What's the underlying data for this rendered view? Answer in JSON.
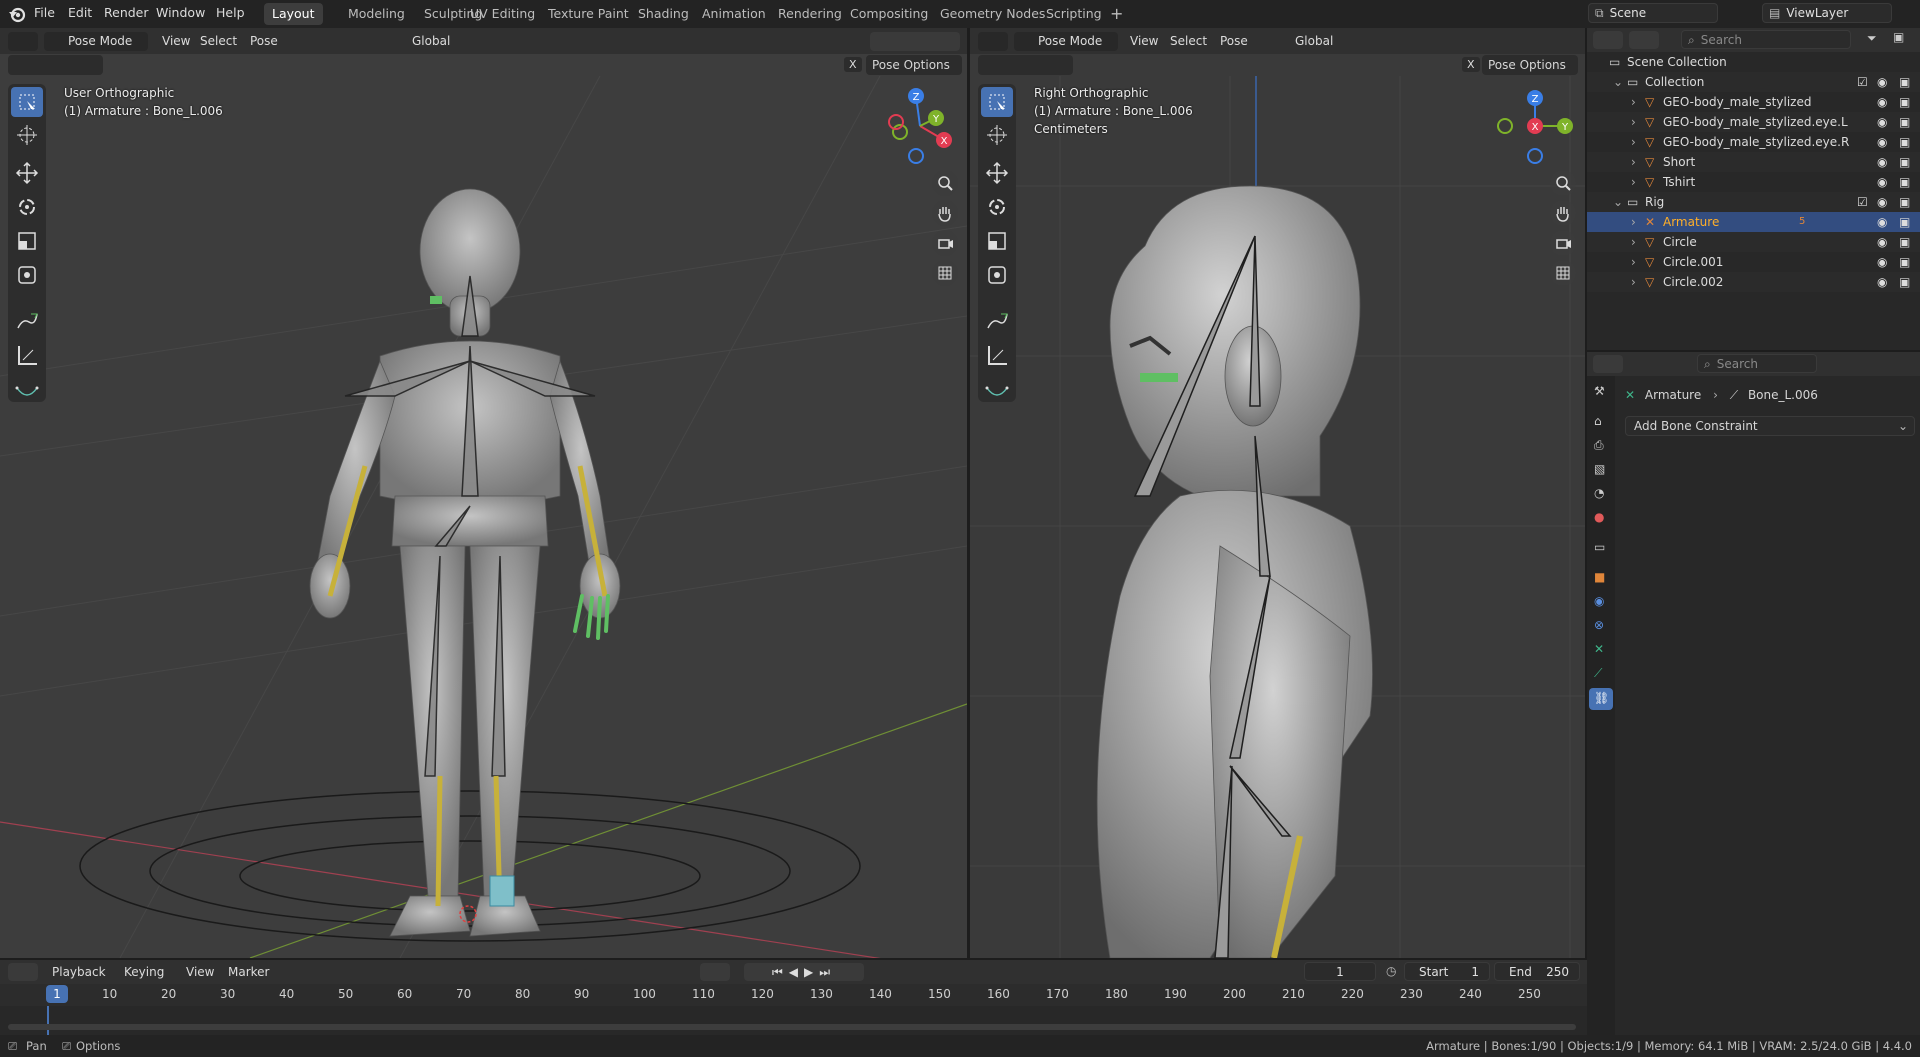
{
  "topbar": {
    "menus": [
      "File",
      "Edit",
      "Render",
      "Window",
      "Help"
    ],
    "workspaces": [
      "Layout",
      "Modeling",
      "Sculpting",
      "UV Editing",
      "Texture Paint",
      "Shading",
      "Animation",
      "Rendering",
      "Compositing",
      "Geometry Nodes",
      "Scripting"
    ],
    "active_workspace": "Layout",
    "scene": "Scene",
    "view_layer": "ViewLayer"
  },
  "left_viewport": {
    "mode": "Pose Mode",
    "menus": [
      "View",
      "Select",
      "Pose"
    ],
    "orientation": "Global",
    "pose_options": "Pose Options",
    "info_view": "User Orthographic",
    "info_object": "(1) Armature : Bone_L.006",
    "close_label": "X"
  },
  "right_viewport": {
    "mode": "Pose Mode",
    "menus": [
      "View",
      "Select",
      "Pose"
    ],
    "orientation": "Global",
    "pose_options": "Pose Options",
    "info_view": "Right Orthographic",
    "info_object": "(1) Armature : Bone_L.006",
    "info_units": "Centimeters",
    "close_label": "X"
  },
  "gizmo": {
    "x": "X",
    "y": "Y",
    "z": "Z"
  },
  "outliner": {
    "search_placeholder": "Search",
    "rows": [
      {
        "label": "Scene Collection",
        "indent": 0,
        "kind": "scene"
      },
      {
        "label": "Collection",
        "indent": 1,
        "kind": "collection"
      },
      {
        "label": "GEO-body_male_stylized",
        "indent": 2,
        "kind": "mesh"
      },
      {
        "label": "GEO-body_male_stylized.eye.L",
        "indent": 2,
        "kind": "mesh"
      },
      {
        "label": "GEO-body_male_stylized.eye.R",
        "indent": 2,
        "kind": "mesh"
      },
      {
        "label": "Short",
        "indent": 2,
        "kind": "mesh"
      },
      {
        "label": "Tshirt",
        "indent": 2,
        "kind": "mesh"
      },
      {
        "label": "Rig",
        "indent": 1,
        "kind": "collection"
      },
      {
        "label": "Armature",
        "indent": 2,
        "kind": "armature",
        "selected": true,
        "badge": "5"
      },
      {
        "label": "Circle",
        "indent": 2,
        "kind": "mesh"
      },
      {
        "label": "Circle.001",
        "indent": 2,
        "kind": "mesh"
      },
      {
        "label": "Circle.002",
        "indent": 2,
        "kind": "mesh"
      }
    ]
  },
  "properties": {
    "search_placeholder": "Search",
    "breadcrumb_object": "Armature",
    "breadcrumb_bone": "Bone_L.006",
    "add_constraint": "Add Bone Constraint"
  },
  "timeline": {
    "menus": [
      "Playback",
      "Keying",
      "View",
      "Marker"
    ],
    "current_frame": "1",
    "start_label": "Start",
    "start_value": "1",
    "end_label": "End",
    "end_value": "250",
    "ruler": [
      "10",
      "20",
      "30",
      "40",
      "50",
      "60",
      "70",
      "80",
      "90",
      "100",
      "110",
      "120",
      "130",
      "140",
      "150",
      "160",
      "170",
      "180",
      "190",
      "200",
      "210",
      "220",
      "230",
      "240",
      "250"
    ],
    "playhead": "1"
  },
  "statusbar": {
    "pan": "Pan",
    "options": "Options",
    "stats": "Armature | Bones:1/90 | Objects:1/9 | Memory: 64.1 MiB | VRAM: 2.5/24.0 GiB | 4.4.0"
  },
  "colors": {
    "accent": "#4772b3",
    "selected_row": "#334d80",
    "axis_x": "#e23c52",
    "axis_y": "#7fb32a",
    "axis_z": "#3a7ee6",
    "active_text": "#ffaf29"
  }
}
